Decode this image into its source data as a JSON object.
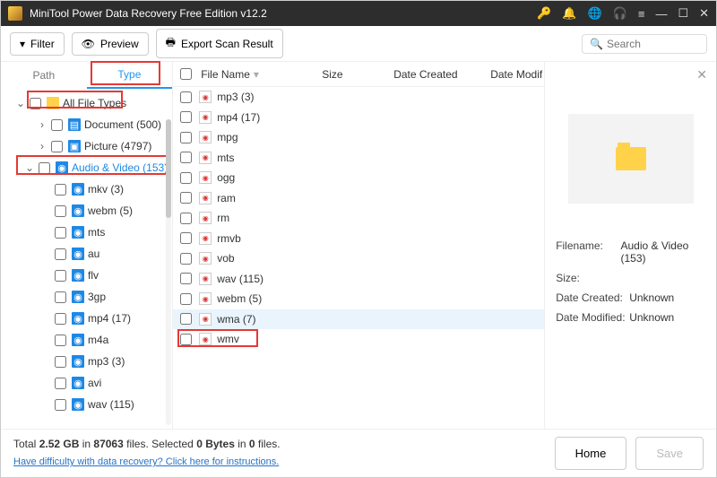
{
  "titlebar": {
    "title": "MiniTool Power Data Recovery Free Edition v12.2"
  },
  "toolbar": {
    "filter": "Filter",
    "preview": "Preview",
    "export": "Export Scan Result",
    "search_placeholder": "Search"
  },
  "tabs": {
    "path": "Path",
    "type": "Type"
  },
  "tree": {
    "root": "All File Types",
    "docs": "Document (500)",
    "pics": "Picture (4797)",
    "av": "Audio & Video (153)",
    "items": [
      "mkv (3)",
      "webm (5)",
      "mts",
      "au",
      "flv",
      "3gp",
      "mp4 (17)",
      "m4a",
      "mp3 (3)",
      "avi",
      "wav (115)"
    ]
  },
  "cols": {
    "name": "File Name",
    "size": "Size",
    "dc": "Date Created",
    "dm": "Date Modif"
  },
  "files": [
    "mp3 (3)",
    "mp4 (17)",
    "mpg",
    "mts",
    "ogg",
    "ram",
    "rm",
    "rmvb",
    "vob",
    "wav (115)",
    "webm (5)",
    "wma (7)",
    "wmv"
  ],
  "preview": {
    "filename_lbl": "Filename:",
    "filename_val": "Audio & Video (153)",
    "size_lbl": "Size:",
    "size_val": "",
    "dc_lbl": "Date Created:",
    "dc_val": "Unknown",
    "dm_lbl": "Date Modified:",
    "dm_val": "Unknown"
  },
  "status": {
    "total_pre": "Total ",
    "total_size": "2.52 GB",
    "total_mid": " in ",
    "total_files": "87063",
    "total_suf": " files.",
    "sel_pre": "   Selected ",
    "sel_bytes": "0 Bytes",
    "sel_mid": " in ",
    "sel_files": "0",
    "sel_suf": " files.",
    "help": "Have difficulty with data recovery? Click here for instructions."
  },
  "buttons": {
    "home": "Home",
    "save": "Save"
  }
}
